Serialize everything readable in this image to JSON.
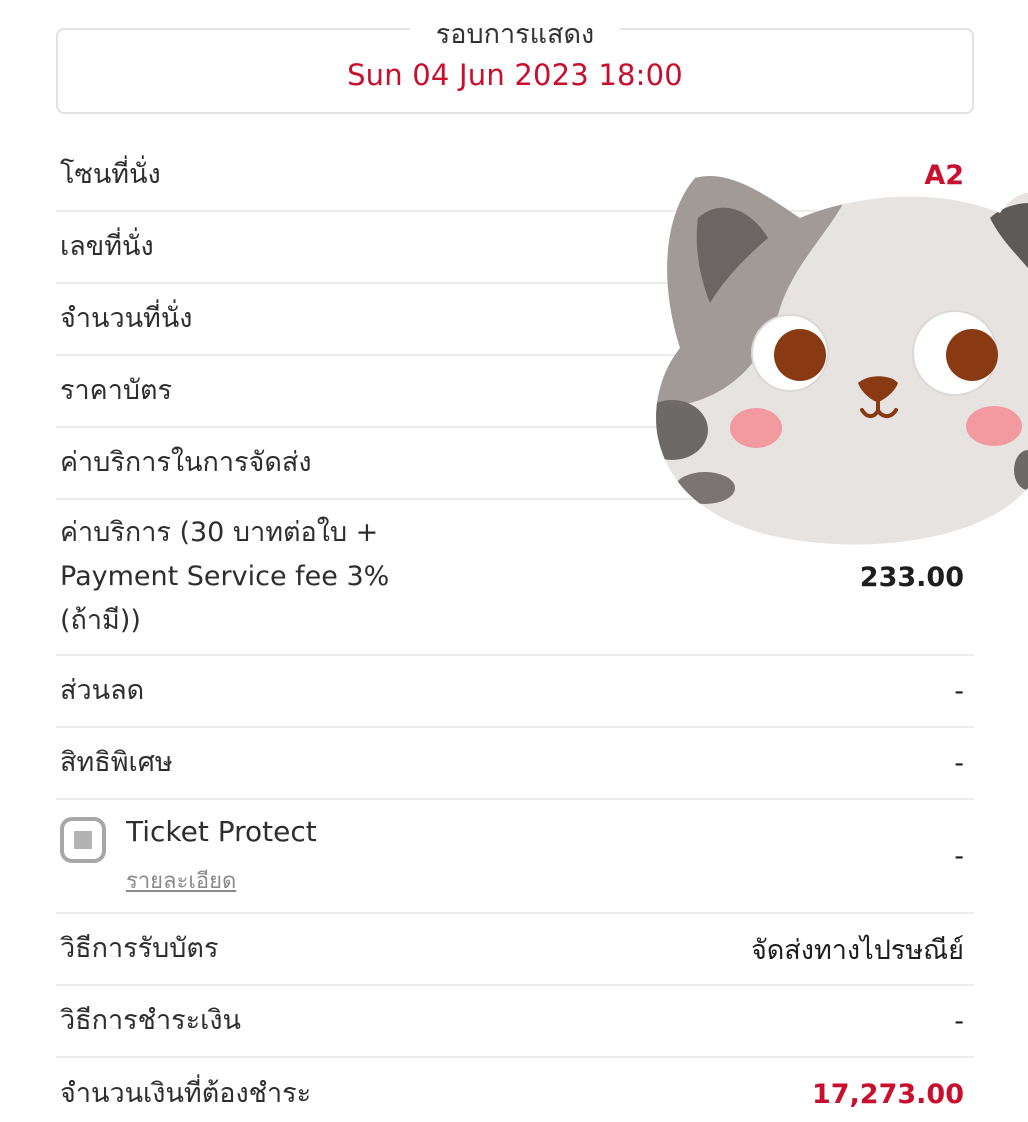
{
  "showtime": {
    "legend": "รอบการแสดง",
    "datetime": "Sun 04 Jun 2023 18:00"
  },
  "rows": {
    "zone": {
      "label": "โซนที่นั่ง",
      "value": "A2"
    },
    "seat_number": {
      "label": "เลขที่นั่ง"
    },
    "seat_count": {
      "label": "จำนวนที่นั่ง"
    },
    "ticket_price": {
      "label": "ราคาบัตร"
    },
    "delivery_fee": {
      "label": "ค่าบริการในการจัดส่ง"
    },
    "service_fee": {
      "label": "ค่าบริการ (30 บาทต่อใบ +\nPayment Service fee 3%\n(ถ้ามี))",
      "value": "233.00"
    },
    "discount": {
      "label": "ส่วนลด",
      "value": "-"
    },
    "privilege": {
      "label": "สิทธิพิเศษ",
      "value": "-"
    },
    "ticket_protect": {
      "label": "Ticket Protect",
      "details_link": "รายละเอียด",
      "value": "-"
    },
    "receive_method": {
      "label": "วิธีการรับบัตร",
      "value": "จัดส่งทางไปรษณีย์"
    },
    "payment_method": {
      "label": "วิธีการชำระเงิน",
      "value": "-"
    },
    "total": {
      "label": "จำนวนเงินที่ต้องชำระ",
      "value": "17,273.00"
    }
  },
  "colors": {
    "accent_red": "#c8102e",
    "divider": "#ececec"
  },
  "icons": {
    "sticker": "cat-face-sticker",
    "checkbox": "checkbox-icon"
  }
}
